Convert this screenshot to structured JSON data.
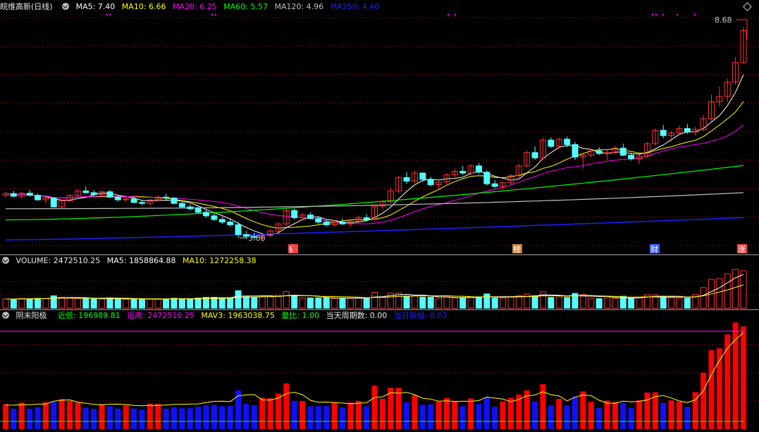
{
  "main_legend": {
    "title": "皖维高新(日线)",
    "ma5": "MA5: 7.40",
    "ma10": "MA10: 6.66",
    "ma20": "MA20: 6.25",
    "ma60": "MA60: 5.57",
    "ma120": "MA120: 4.96",
    "ma250": "MA250: 4.40"
  },
  "annotations": {
    "high": "8.68",
    "low": "3.86",
    "m1": "§",
    "m2": "榜",
    "m3": "财",
    "m4": "涨"
  },
  "volume_legend": {
    "label": "VOLUME: 2472510.25",
    "ma5": "MA5: 1858864.88",
    "ma10": "MA10: 1272258.38"
  },
  "ind_legend": {
    "name": "阴末阳极",
    "low": "近低: 196989.81",
    "high": "近高: 2472510.25",
    "mav3": "MAV3: 1963038.75",
    "ratio": "量比: 1.00",
    "days": "当天周期数: 0.00",
    "today": "当日振幅: 0.03"
  },
  "colors": {
    "up": "#ff3232",
    "down": "#54ffff",
    "ma5": "#ffffff",
    "ma10": "#ffff00",
    "ma20": "#ff00ff",
    "ma60": "#00ff00",
    "ma120": "#c0c0c0",
    "ma250": "#2020ff",
    "grid": "#8b0000",
    "ind_up": "#ff0000",
    "ind_down": "#1010ff"
  },
  "chart_data": {
    "type": "candlestick",
    "price_range": [
      3.6,
      9.0
    ],
    "candles_ohlc": [
      [
        4.9,
        4.98,
        4.84,
        4.94
      ],
      [
        4.94,
        5.0,
        4.86,
        4.88
      ],
      [
        4.88,
        4.98,
        4.82,
        4.95
      ],
      [
        4.95,
        5.02,
        4.88,
        4.9
      ],
      [
        4.9,
        4.94,
        4.78,
        4.8
      ],
      [
        4.8,
        4.88,
        4.72,
        4.84
      ],
      [
        4.84,
        4.86,
        4.62,
        4.64
      ],
      [
        4.64,
        4.8,
        4.6,
        4.78
      ],
      [
        4.78,
        4.92,
        4.74,
        4.9
      ],
      [
        4.9,
        5.02,
        4.86,
        5.0
      ],
      [
        5.0,
        5.1,
        4.94,
        4.96
      ],
      [
        4.96,
        5.02,
        4.88,
        4.92
      ],
      [
        4.92,
        5.0,
        4.86,
        4.98
      ],
      [
        4.98,
        5.02,
        4.84,
        4.86
      ],
      [
        4.86,
        4.9,
        4.76,
        4.8
      ],
      [
        4.8,
        4.86,
        4.74,
        4.82
      ],
      [
        4.82,
        4.86,
        4.72,
        4.74
      ],
      [
        4.74,
        4.8,
        4.68,
        4.72
      ],
      [
        4.72,
        4.82,
        4.68,
        4.8
      ],
      [
        4.8,
        4.9,
        4.76,
        4.86
      ],
      [
        4.86,
        4.94,
        4.8,
        4.84
      ],
      [
        4.84,
        4.86,
        4.7,
        4.72
      ],
      [
        4.72,
        4.76,
        4.62,
        4.64
      ],
      [
        4.64,
        4.7,
        4.56,
        4.6
      ],
      [
        4.6,
        4.66,
        4.5,
        4.52
      ],
      [
        4.52,
        4.58,
        4.4,
        4.44
      ],
      [
        4.44,
        4.5,
        4.32,
        4.36
      ],
      [
        4.36,
        4.42,
        4.26,
        4.3
      ],
      [
        4.3,
        4.36,
        4.2,
        4.24
      ],
      [
        4.24,
        4.3,
        3.94,
        4.02
      ],
      [
        4.02,
        4.1,
        3.92,
        3.98
      ],
      [
        3.98,
        4.06,
        3.9,
        3.96
      ],
      [
        3.96,
        4.04,
        3.86,
        4.0
      ],
      [
        4.0,
        4.14,
        3.96,
        4.1
      ],
      [
        4.1,
        4.3,
        4.06,
        4.26
      ],
      [
        4.26,
        4.6,
        4.22,
        4.56
      ],
      [
        4.56,
        4.6,
        4.36,
        4.4
      ],
      [
        4.4,
        4.5,
        4.34,
        4.46
      ],
      [
        4.46,
        4.52,
        4.36,
        4.38
      ],
      [
        4.38,
        4.42,
        4.26,
        4.3
      ],
      [
        4.3,
        4.36,
        4.2,
        4.24
      ],
      [
        4.24,
        4.34,
        4.2,
        4.3
      ],
      [
        4.3,
        4.38,
        4.24,
        4.26
      ],
      [
        4.26,
        4.34,
        4.2,
        4.32
      ],
      [
        4.32,
        4.44,
        4.28,
        4.4
      ],
      [
        4.4,
        4.48,
        4.32,
        4.36
      ],
      [
        4.36,
        4.7,
        4.34,
        4.66
      ],
      [
        4.66,
        4.8,
        4.6,
        4.76
      ],
      [
        4.76,
        5.08,
        4.72,
        5.0
      ],
      [
        5.0,
        5.34,
        4.96,
        5.3
      ],
      [
        5.3,
        5.42,
        5.16,
        5.22
      ],
      [
        5.22,
        5.46,
        5.18,
        5.4
      ],
      [
        5.4,
        5.42,
        5.2,
        5.26
      ],
      [
        5.26,
        5.32,
        5.1,
        5.14
      ],
      [
        5.14,
        5.22,
        5.04,
        5.2
      ],
      [
        5.2,
        5.4,
        5.16,
        5.36
      ],
      [
        5.36,
        5.5,
        5.3,
        5.44
      ],
      [
        5.44,
        5.56,
        5.36,
        5.4
      ],
      [
        5.4,
        5.6,
        5.36,
        5.56
      ],
      [
        5.56,
        5.62,
        5.38,
        5.42
      ],
      [
        5.42,
        5.46,
        5.12,
        5.16
      ],
      [
        5.16,
        5.24,
        5.06,
        5.1
      ],
      [
        5.1,
        5.2,
        5.02,
        5.18
      ],
      [
        5.18,
        5.38,
        5.14,
        5.34
      ],
      [
        5.34,
        5.6,
        5.3,
        5.56
      ],
      [
        5.56,
        5.9,
        5.52,
        5.86
      ],
      [
        5.86,
        6.0,
        5.7,
        5.74
      ],
      [
        5.74,
        6.2,
        5.7,
        6.14
      ],
      [
        6.14,
        6.2,
        5.96,
        6.0
      ],
      [
        6.0,
        6.2,
        5.94,
        6.16
      ],
      [
        6.16,
        6.22,
        5.98,
        6.04
      ],
      [
        6.04,
        6.1,
        5.7,
        5.76
      ],
      [
        5.76,
        5.86,
        5.5,
        5.8
      ],
      [
        5.8,
        5.94,
        5.74,
        5.9
      ],
      [
        5.9,
        5.98,
        5.8,
        5.84
      ],
      [
        5.84,
        5.92,
        5.7,
        5.86
      ],
      [
        5.86,
        6.02,
        5.82,
        5.96
      ],
      [
        5.96,
        6.06,
        5.78,
        5.8
      ],
      [
        5.8,
        5.86,
        5.68,
        5.72
      ],
      [
        5.72,
        5.82,
        5.6,
        5.78
      ],
      [
        5.78,
        6.1,
        5.74,
        6.06
      ],
      [
        6.06,
        6.4,
        6.02,
        6.36
      ],
      [
        6.36,
        6.48,
        6.18,
        6.24
      ],
      [
        6.24,
        6.34,
        6.1,
        6.3
      ],
      [
        6.3,
        6.46,
        6.24,
        6.4
      ],
      [
        6.4,
        6.5,
        6.28,
        6.32
      ],
      [
        6.32,
        6.44,
        6.24,
        6.38
      ],
      [
        6.38,
        6.7,
        6.34,
        6.62
      ],
      [
        6.62,
        7.16,
        6.56,
        7.0
      ],
      [
        7.0,
        7.34,
        6.9,
        7.12
      ],
      [
        7.12,
        7.52,
        7.0,
        7.44
      ],
      [
        7.44,
        8.0,
        7.38,
        7.88
      ],
      [
        7.88,
        8.68,
        7.84,
        8.6
      ]
    ],
    "volume_range": [
      0,
      2700000
    ],
    "volume_ma5_last": 1858864.88,
    "volume_ma10_last": 1272258.38,
    "indicator_range": [
      0,
      2700000
    ],
    "indicator_high_line": 2472510.25,
    "indicator_low_line": 196989.81
  }
}
